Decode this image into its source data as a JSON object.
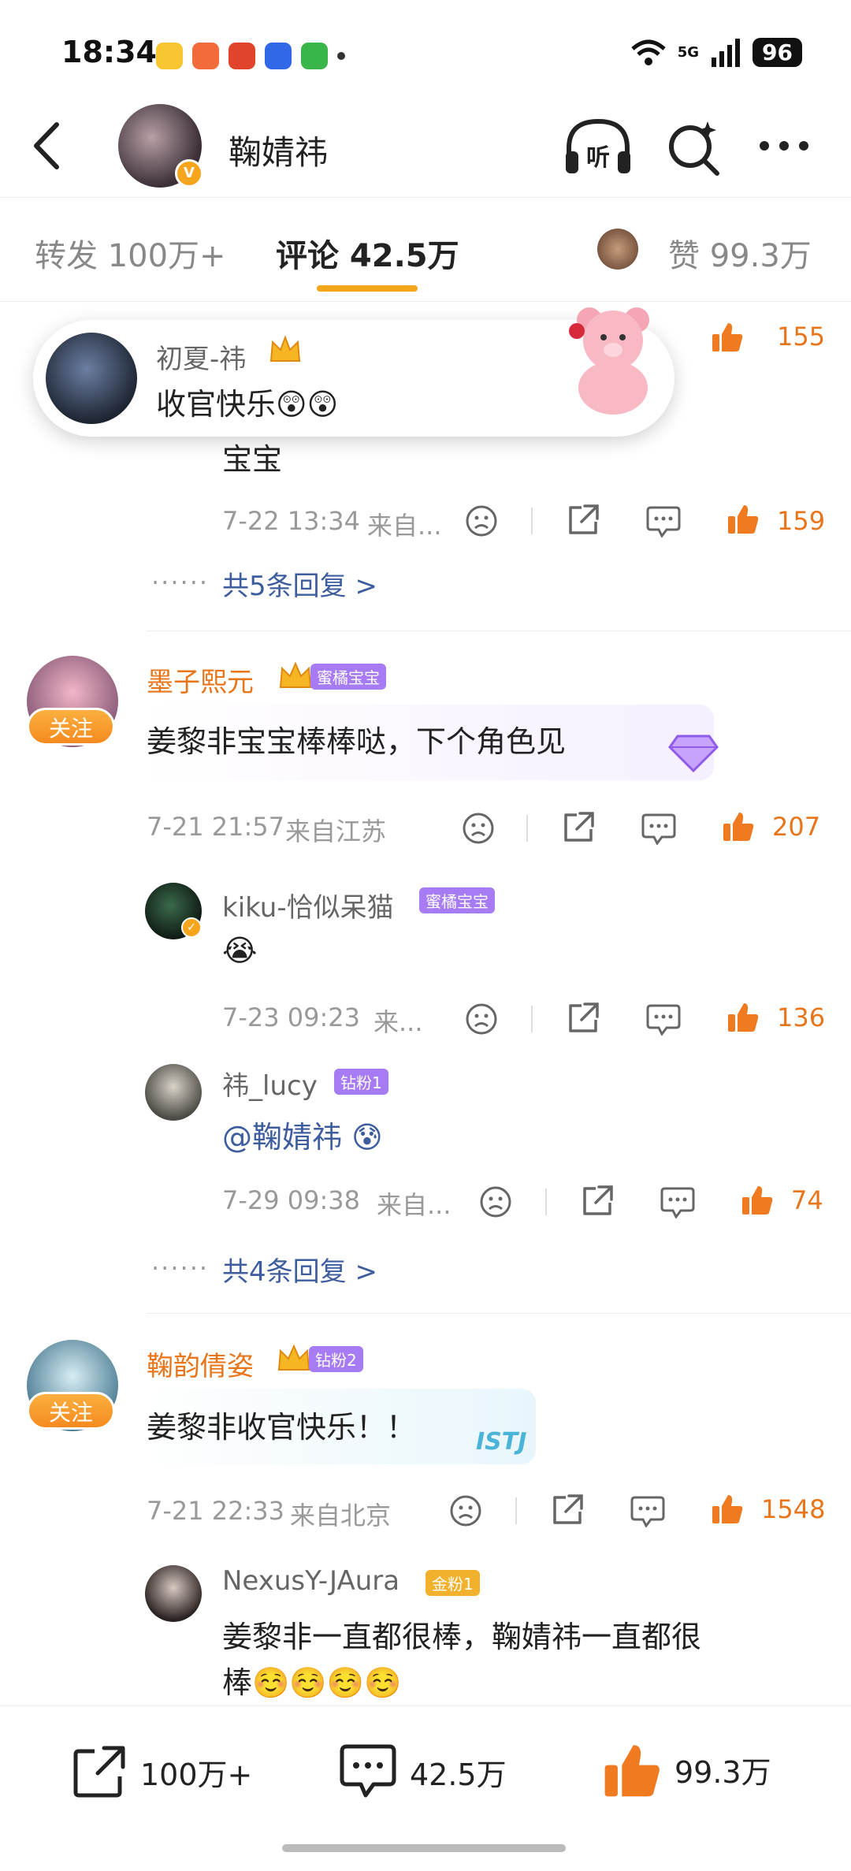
{
  "status": {
    "time": "18:34",
    "network": "5G",
    "battery": "96"
  },
  "header": {
    "title": "鞠婧祎",
    "verified_badge": "V"
  },
  "tabs": {
    "repost": "转发 100万+",
    "comment": "评论 42.5万",
    "like": "赞 99.3万"
  },
  "toast": {
    "user": "初夏-祎",
    "text": "收官快乐😲😲",
    "likes": "155"
  },
  "comment0": {
    "text_tail": "宝宝",
    "time": "7-22 13:34",
    "source": "来自...",
    "likes": "159",
    "more": "共5条回复 >"
  },
  "comment1": {
    "user": "墨子熙元",
    "badge": "蜜橘宝宝",
    "follow": "关注",
    "text": "姜黎非宝宝棒棒哒，下个角色见",
    "time": "7-21 21:57",
    "source": "来自江苏",
    "likes": "207",
    "replies": [
      {
        "user": "kiku-恰似呆猫",
        "badge": "蜜橘宝宝",
        "text": "😭",
        "time": "7-23 09:23",
        "source": "来...",
        "likes": "136"
      },
      {
        "user": "祎_lucy",
        "badge": "钻粉1",
        "text": "@鞠婧祎 😰",
        "time": "7-29 09:38",
        "source": "来自...",
        "likes": "74"
      }
    ],
    "more": "共4条回复 >"
  },
  "comment2": {
    "user": "鞠韵倩姿",
    "badge": "钻粉2",
    "follow": "关注",
    "text": "姜黎非收官快乐！！",
    "sticker": "ISTJ",
    "time": "7-21 22:33",
    "source": "来自北京",
    "likes": "1548",
    "reply": {
      "user": "NexusY-JAura",
      "badge": "金粉1",
      "text_line1": "姜黎非一直都很棒，鞠婧祎一直都很",
      "text_line2": "棒☺️☺️☺️☺️"
    }
  },
  "bottom": {
    "repost": "100万+",
    "comment": "42.5万",
    "like": "99.3万"
  },
  "colors": {
    "accent": "#f7a51c",
    "like": "#e8751a",
    "link": "#3d5d9e",
    "badge_purple": "#a77bf3"
  }
}
